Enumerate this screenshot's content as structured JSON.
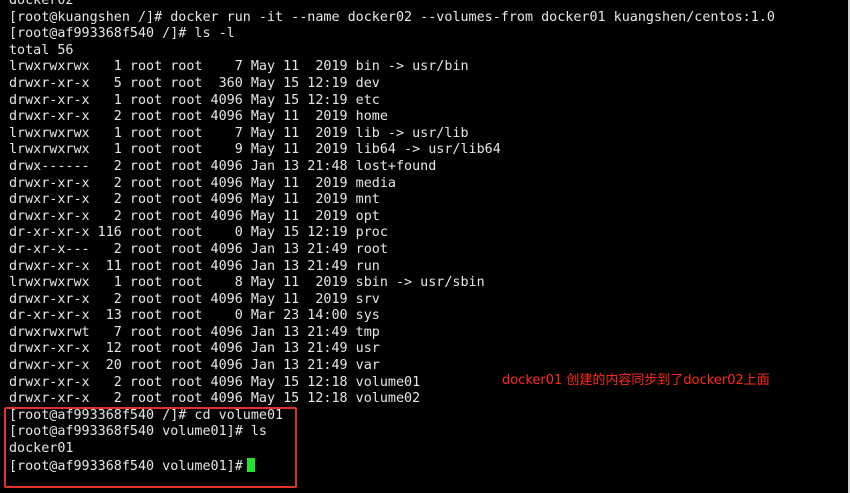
{
  "terminal": {
    "lines": [
      "docker02",
      "[root@kuangshen /]# docker run -it --name docker02 --volumes-from docker01 kuangshen/centos:1.0",
      "[root@af993368f540 /]# ls -l",
      "total 56",
      "lrwxrwxrwx   1 root root    7 May 11  2019 bin -> usr/bin",
      "drwxr-xr-x   5 root root  360 May 15 12:19 dev",
      "drwxr-xr-x   1 root root 4096 May 15 12:19 etc",
      "drwxr-xr-x   2 root root 4096 May 11  2019 home",
      "lrwxrwxrwx   1 root root    7 May 11  2019 lib -> usr/lib",
      "lrwxrwxrwx   1 root root    9 May 11  2019 lib64 -> usr/lib64",
      "drwx------   2 root root 4096 Jan 13 21:48 lost+found",
      "drwxr-xr-x   2 root root 4096 May 11  2019 media",
      "drwxr-xr-x   2 root root 4096 May 11  2019 mnt",
      "drwxr-xr-x   2 root root 4096 May 11  2019 opt",
      "dr-xr-xr-x 116 root root    0 May 15 12:19 proc",
      "dr-xr-x---   2 root root 4096 Jan 13 21:49 root",
      "drwxr-xr-x  11 root root 4096 Jan 13 21:49 run",
      "lrwxrwxrwx   1 root root    8 May 11  2019 sbin -> usr/sbin",
      "drwxr-xr-x   2 root root 4096 May 11  2019 srv",
      "dr-xr-xr-x  13 root root    0 Mar 23 14:00 sys",
      "drwxrwxrwt   7 root root 4096 Jan 13 21:49 tmp",
      "drwxr-xr-x  12 root root 4096 Jan 13 21:49 usr",
      "drwxr-xr-x  20 root root 4096 Jan 13 21:49 var",
      "drwxr-xr-x   2 root root 4096 May 15 12:18 volume01",
      "drwxr-xr-x   2 root root 4096 May 15 12:18 volume02",
      "[root@af993368f540 /]# cd volume01",
      "[root@af993368f540 volume01]# ls",
      "docker01"
    ],
    "prompt": "[root@af993368f540 volume01]#"
  },
  "annotation": {
    "text": "docker01 创建的内容同步到了docker02上面",
    "color": "#ff2a1a"
  },
  "colors": {
    "background": "#000000",
    "text": "#e6e6e6",
    "cursor": "#22e32a",
    "highlight_border": "#e0322b"
  }
}
